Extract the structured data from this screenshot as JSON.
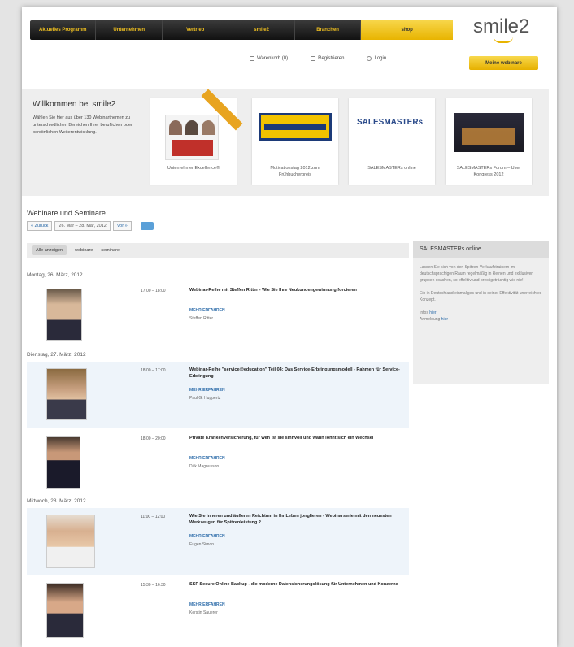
{
  "nav": {
    "items": [
      "Aktuelles Programm",
      "Unternehmen",
      "Vertrieb",
      "smile2",
      "Branchen"
    ],
    "shop": "shop"
  },
  "logo": "smile2",
  "utils": {
    "cart": "Warenkorb (0)",
    "register": "Registrieren",
    "login": "Login"
  },
  "webinar_button": "Meine webinare",
  "welcome": {
    "title": "Willkommen bei smile2",
    "text": "Wählen Sie hier aus über 130 Webinarthemen zu unterschiedlichen Bereichen Ihrer beruflichen oder persönlichen Weiterentwicklung.",
    "cards": [
      {
        "caption": "Unternehmer Excellence®"
      },
      {
        "caption": "Motivationstag 2012 zum Frühbucherpreis"
      },
      {
        "caption": "SALESMASTERs online"
      },
      {
        "caption": "SALESMASTERs Forum – User Kongress 2012"
      }
    ]
  },
  "section": {
    "title": "Webinare und Seminare",
    "back": "« Zurück",
    "range": "26. Mär – 28. Mär, 2012",
    "next": "Vor »"
  },
  "tabs": [
    "Alle anzeigen",
    "webinare",
    "seminare"
  ],
  "days": [
    "Montag, 26. März, 2012",
    "Dienstag, 27. März, 2012",
    "Mittwoch, 28. März, 2012"
  ],
  "events": [
    {
      "time": "17:00 – 18:00",
      "title": "Webinar-Reihe mit Steffen Ritter - Wie Sie Ihre Neukundengewinnung forcieren",
      "more": "MEHR ERFAHREN",
      "speaker": "Steffen Ritter"
    },
    {
      "time": "18:00 – 17:00",
      "title": "Webinar-Reihe \"service@education\" Teil 04: Das Service-Erbringungsmodell - Rahmen für Service-Erbringung",
      "more": "MEHR ERFAHREN",
      "speaker": "Paul G. Huppertz"
    },
    {
      "time": "18:00 – 20:00",
      "title": "Private Krankenversicherung, für wen ist sie sinnvoll und wann lohnt sich ein Wechsel",
      "more": "MEHR ERFAHREN",
      "speaker": "Dirk Magnusson"
    },
    {
      "time": "11:00 – 12:00",
      "title": "Wie Sie inneren und äußeren Reichtum in Ihr Leben jonglieren - Webinarserie mit den neuesten Werkzeugen für Spitzenleistung 2",
      "more": "MEHR ERFAHREN",
      "speaker": "Eugen Simon"
    },
    {
      "time": "15:30 – 16:30",
      "title": "SSP Secure Online Backup - die moderne Datensicherungslösung für Unternehmen und Konzerne",
      "more": "MEHR ERFAHREN",
      "speaker": "Kerstin Sauerer"
    }
  ],
  "sidebar": {
    "title": "SALESMASTERs online",
    "text1": "Lassen Sie sich von den Spitzen-Verkaufstrainern im deutschsprachigen Raum regelmäßig in kleinen und exklusiven gruppen coachen, so effektiv und prestigeträchtig wie nie!",
    "text2": "Ein in Deutschland einmaliges und in seiner Effektivität unerreichtes Konzept.",
    "info_label": "Infos",
    "info_link": "hier",
    "signup_label": "Anmeldung",
    "signup_link": "hier"
  }
}
